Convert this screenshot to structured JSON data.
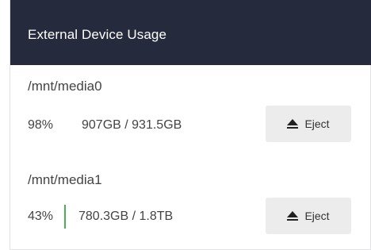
{
  "header": {
    "title": "External Device Usage"
  },
  "devices": [
    {
      "path": "/mnt/media0",
      "percent": "98%",
      "size": "907GB / 931.5GB",
      "eject_label": "Eject"
    },
    {
      "path": "/mnt/media1",
      "percent": "43%",
      "size": "780.3GB / 1.8TB",
      "eject_label": "Eject"
    }
  ],
  "colors": {
    "header_bg": "#262a3d",
    "usage_bar": "#4caf50",
    "button_bg": "#ececec"
  },
  "icons": {
    "eject": "eject-icon"
  }
}
